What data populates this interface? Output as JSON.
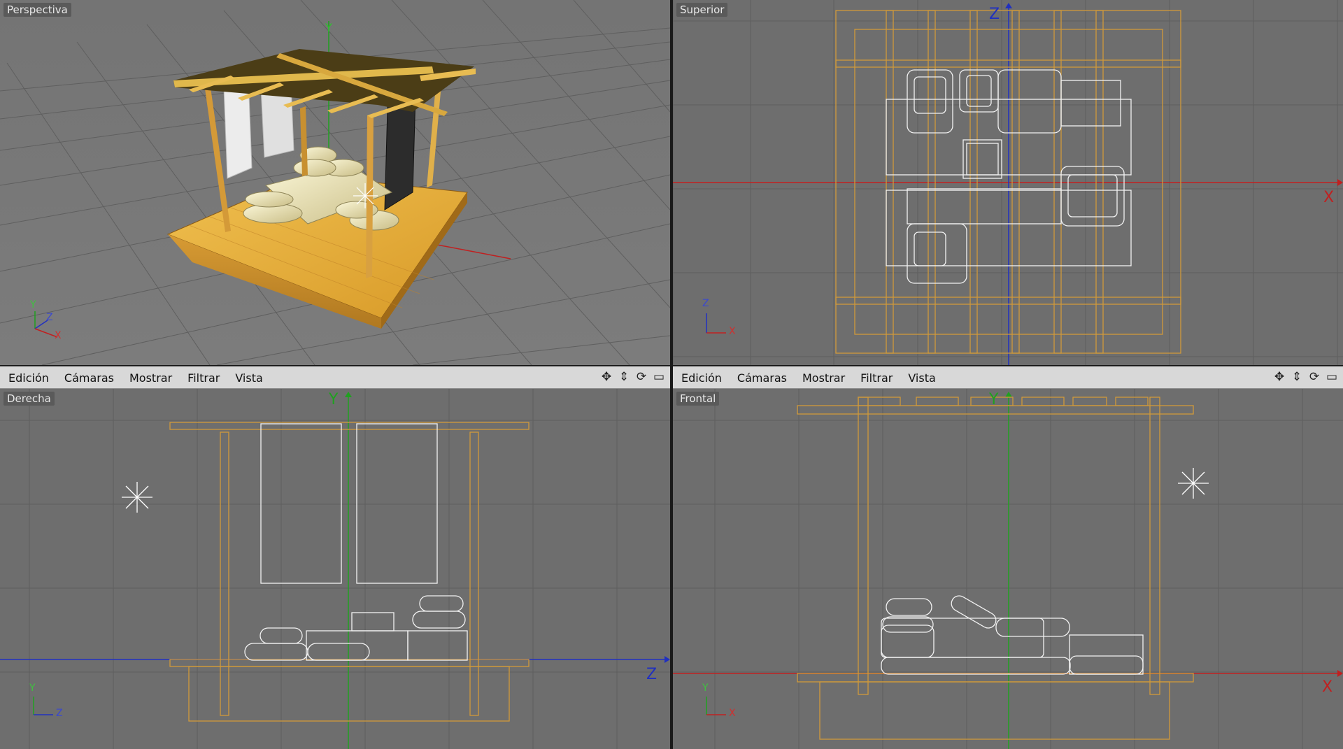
{
  "viewports": {
    "perspective": {
      "label": "Perspectiva"
    },
    "top": {
      "label": "Superior",
      "axis_h": "X",
      "axis_v": "Z"
    },
    "right": {
      "label": "Derecha",
      "axis_h": "Z",
      "axis_v": "Y"
    },
    "front": {
      "label": "Frontal",
      "axis_h": "X",
      "axis_v": "Y"
    }
  },
  "menubar": {
    "items": [
      "Edición",
      "Cámaras",
      "Mostrar",
      "Filtrar",
      "Vista"
    ],
    "icons": [
      "move-view-icon",
      "zoom-view-icon",
      "rotate-view-icon",
      "maximize-view-icon"
    ]
  },
  "mini_axes": {
    "y": "Y",
    "z": "Z",
    "x": "X"
  },
  "colors": {
    "viewport_bg": "#6e6e6e",
    "grid": "#5c5c5c",
    "wire_wood": "#d09a3a",
    "wire_cloth": "#f2f2f2",
    "axis_x": "#c02020",
    "axis_y": "#20a020",
    "axis_z": "#2030c0"
  }
}
